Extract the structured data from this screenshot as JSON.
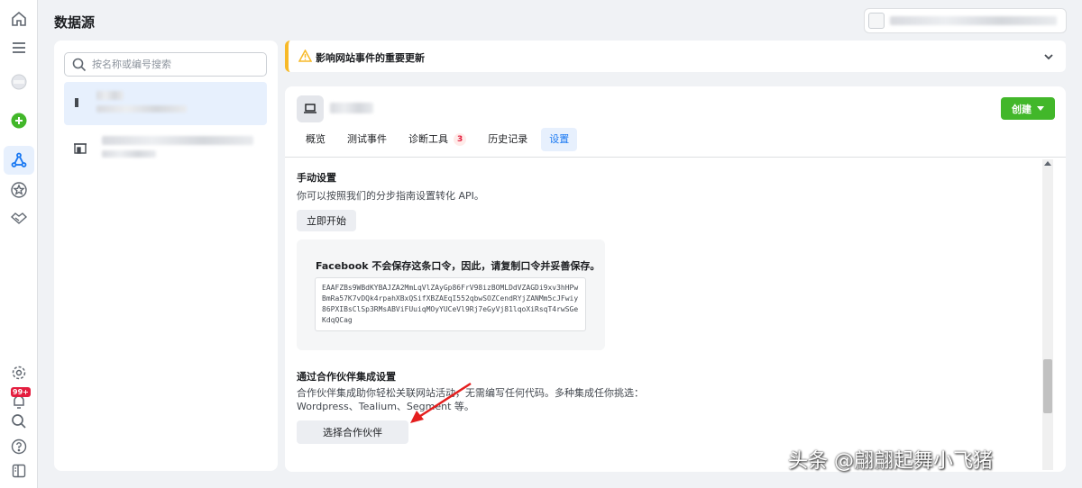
{
  "page": {
    "title": "数据源"
  },
  "rail": {
    "icons": [
      "home-icon",
      "menu-icon",
      "profile-avatar",
      "create-plus-icon",
      "data-sources-icon",
      "star-icon",
      "partner-icon",
      "settings-icon",
      "notifications-icon",
      "search-icon",
      "help-icon",
      "sidebar-toggle-icon"
    ],
    "notifications_badge": "99+"
  },
  "search": {
    "placeholder": "按名称或编号搜索"
  },
  "notice": {
    "text": "影响网站事件的重要更新"
  },
  "main": {
    "create_label": "创建",
    "tabs": [
      {
        "label": "概览"
      },
      {
        "label": "测试事件"
      },
      {
        "label": "诊断工具",
        "count": "3"
      },
      {
        "label": "历史记录"
      },
      {
        "label": "设置"
      }
    ],
    "manual": {
      "heading": "手动设置",
      "description": "你可以按照我们的分步指南设置转化 API。",
      "start_button": "立即开始",
      "token_warning": "Facebook 不会保存这条口令，因此，请复制口令并妥善保存。",
      "token": "EAAFZBs9WBdKYBAJZA2MmLqVlZAyGp86FrV98izBOMLDdVZAGDi9xv3hHPwBmRa57K7vDQk4rpahXBxQSifXBZAEqI552qbwSOZCendRYjZANMm5cJFwiy86PXIBsClSp3RMsABViFUuiqMOyYUCeVl9Rj7eGyVj81lqoXiRsqT4rwSGeKdqQCag"
    },
    "partner": {
      "heading": "通过合作伙伴集成设置",
      "description": "合作伙伴集成助你轻松关联网站活动，无需编写任何代码。多种集成任你挑选：Wordpress、Tealium、Segment 等。",
      "button": "选择合作伙伴"
    }
  },
  "watermark": "头条 @翩翩起舞小飞猪",
  "colors": {
    "accent": "#1877f2",
    "create": "#42b72a",
    "warning": "#f7b928",
    "badge": "#e41e3f"
  }
}
